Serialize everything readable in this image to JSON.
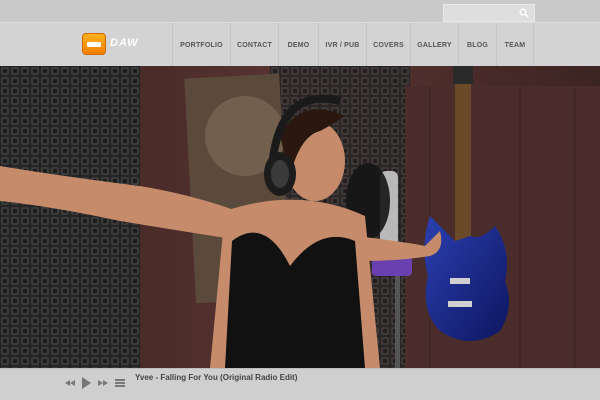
{
  "search": {
    "placeholder": "",
    "icon": "search-icon"
  },
  "logo": {
    "text": "DAW"
  },
  "nav": {
    "items": [
      {
        "label": "PORTFOLIO"
      },
      {
        "label": "CONTACT"
      },
      {
        "label": "DEMO"
      },
      {
        "label": "IVR / PUB"
      },
      {
        "label": "COVERS"
      },
      {
        "label": "GALLERY"
      },
      {
        "label": "BLOG"
      },
      {
        "label": "TEAM"
      }
    ]
  },
  "hero": {
    "image": "singer-in-recording-studio"
  },
  "player": {
    "controls": [
      "previous-icon",
      "play-icon",
      "next-icon",
      "playlist-icon"
    ],
    "track_title": "Yvee - Falling For You (Original Radio Edit)"
  },
  "colors": {
    "logo_accent": "#f39a0c",
    "bar_bg": "#cfcfcf",
    "nav_text": "#555555"
  }
}
